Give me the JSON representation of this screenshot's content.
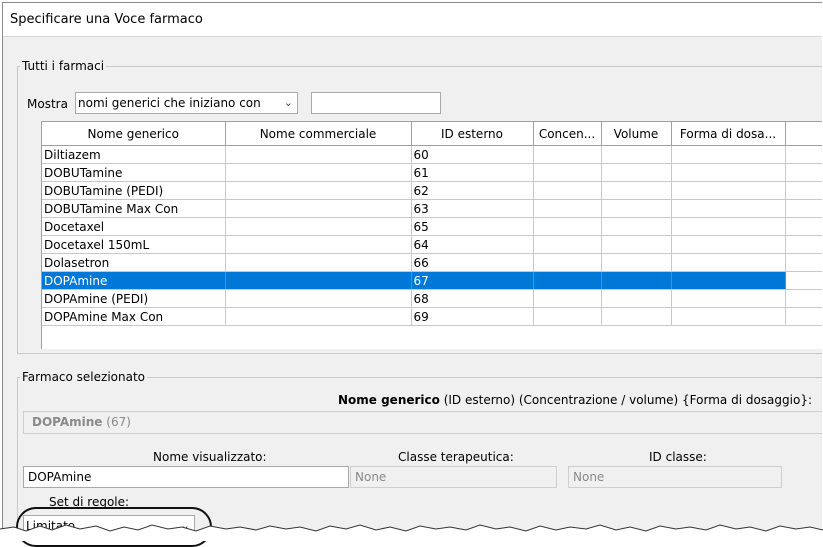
{
  "window": {
    "title": "Specificare una Voce farmaco"
  },
  "all_drugs": {
    "legend": "Tutti i farmaci",
    "filter_label": "Mostra",
    "filter_select": "nomi generici che iniziano con",
    "filter_text": "",
    "columns": [
      "Nome generico",
      "Nome commerciale",
      "ID esterno",
      "Concen...",
      "Volume",
      "Forma di dosa..."
    ],
    "rows": [
      [
        "Diltiazem",
        "",
        "60",
        "",
        "",
        ""
      ],
      [
        "DOBUTamine",
        "",
        "61",
        "",
        "",
        ""
      ],
      [
        "DOBUTamine (PEDI)",
        "",
        "62",
        "",
        "",
        ""
      ],
      [
        "DOBUTamine Max Con",
        "",
        "63",
        "",
        "",
        ""
      ],
      [
        "Docetaxel",
        "",
        "65",
        "",
        "",
        ""
      ],
      [
        "Docetaxel 150mL",
        "",
        "64",
        "",
        "",
        ""
      ],
      [
        "Dolasetron",
        "",
        "66",
        "",
        "",
        ""
      ],
      [
        "DOPAmine",
        "",
        "67",
        "",
        "",
        ""
      ],
      [
        "DOPAmine (PEDI)",
        "",
        "68",
        "",
        "",
        ""
      ],
      [
        "DOPAmine Max Con",
        "",
        "69",
        "",
        "",
        ""
      ]
    ],
    "selected_row": 7
  },
  "selected_drug": {
    "legend": "Farmaco selezionato",
    "format_bold": "Nome generico",
    "format_rest": " (ID esterno) (Concentrazione / volume) {Forma di dosaggio}:",
    "summary_bold": "DOPAmine",
    "summary_rest": " (67)",
    "display_name_label": "Nome visualizzato:",
    "display_name_value": "DOPAmine",
    "therapeutic_class_label": "Classe terapeutica:",
    "therapeutic_class_value": "None",
    "class_id_label": "ID classe:",
    "class_id_value": "None",
    "rule_set_label": "Set di regole:",
    "rule_set_value": "Limitato"
  },
  "colors": {
    "selection": "#0078d7",
    "annotation_circle": "#111111"
  },
  "icons": {
    "dropdown": "chevron-down-icon"
  }
}
